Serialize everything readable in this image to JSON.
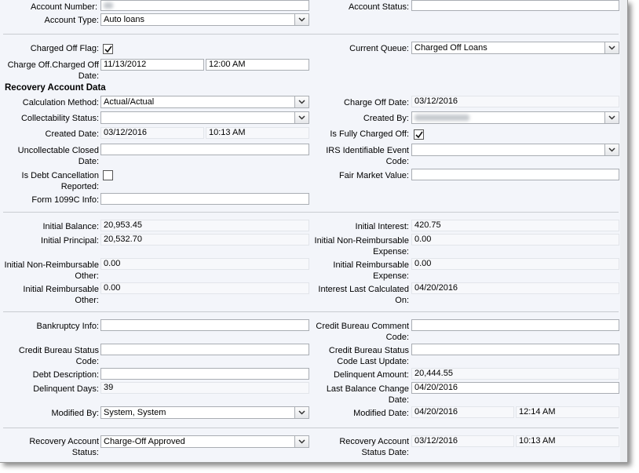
{
  "header": {
    "account_number_label": "Account Number:",
    "account_status_label": "Account Status:",
    "account_status_value": "",
    "account_type_label": "Account Type:",
    "account_type_value": "Auto loans"
  },
  "charge_off": {
    "flag_label": "Charged Off Flag:",
    "flag_checked": true,
    "current_queue_label": "Current Queue:",
    "current_queue_value": "Charged Off Loans",
    "charged_off_date_label": "Charge Off.Charged Off Date:",
    "charged_off_date_value": "11/13/2012",
    "charged_off_time_value": "12:00 AM"
  },
  "recovery": {
    "section_title": "Recovery Account Data",
    "calculation_method_label": "Calculation Method:",
    "calculation_method_value": "Actual/Actual",
    "charge_off_date_label": "Charge Off Date:",
    "charge_off_date_value": "03/12/2016",
    "collectability_status_label": "Collectability Status:",
    "collectability_status_value": "",
    "created_by_label": "Created By:",
    "created_date_label": "Created Date:",
    "created_date_value": "03/12/2016",
    "created_time_value": "10:13 AM",
    "is_fully_charged_off_label": "Is Fully Charged Off:",
    "is_fully_charged_off_checked": true,
    "uncollectable_closed_date_label": "Uncollectable Closed Date:",
    "uncollectable_closed_date_value": "",
    "irs_event_code_label": "IRS Identifiable Event Code:",
    "irs_event_code_value": "",
    "debt_cancellation_label": "Is Debt Cancellation Reported:",
    "debt_cancellation_checked": false,
    "fair_market_value_label": "Fair Market Value:",
    "fair_market_value_value": "",
    "form_1099c_label": "Form 1099C Info:",
    "form_1099c_value": ""
  },
  "balances": {
    "initial_balance_label": "Initial Balance:",
    "initial_balance_value": "20,953.45",
    "initial_interest_label": "Initial Interest:",
    "initial_interest_value": "420.75",
    "initial_principal_label": "Initial Principal:",
    "initial_principal_value": "20,532.70",
    "initial_nonreimb_expense_label": "Initial Non-Reimbursable Expense:",
    "initial_nonreimb_expense_value": "0.00",
    "initial_nonreimb_other_label": "Initial Non-Reimbursable Other:",
    "initial_nonreimb_other_value": "0.00",
    "initial_reimb_expense_label": "Initial Reimbursable Expense:",
    "initial_reimb_expense_value": "0.00",
    "initial_reimb_other_label": "Initial Reimbursable Other:",
    "initial_reimb_other_value": "0.00",
    "interest_last_calculated_label": "Interest Last Calculated On:",
    "interest_last_calculated_value": "04/20/2016"
  },
  "bureau": {
    "bankruptcy_info_label": "Bankruptcy Info:",
    "bankruptcy_info_value": "",
    "credit_bureau_comment_label": "Credit Bureau Comment Code:",
    "credit_bureau_comment_value": "",
    "credit_bureau_status_label": "Credit Bureau Status Code:",
    "credit_bureau_status_value": "",
    "credit_bureau_status_update_label": "Credit Bureau Status Code Last Update:",
    "credit_bureau_status_update_value": "",
    "debt_description_label": "Debt Description:",
    "debt_description_value": "",
    "delinquent_amount_label": "Delinquent Amount:",
    "delinquent_amount_value": "20,444.55",
    "delinquent_days_label": "Delinquent Days:",
    "delinquent_days_value": "39",
    "last_balance_change_label": "Last Balance Change Date:",
    "last_balance_change_value": "04/20/2016",
    "modified_by_label": "Modified By:",
    "modified_by_value": "System, System",
    "modified_date_label": "Modified Date:",
    "modified_date_value": "04/20/2016",
    "modified_time_value": "12:14 AM"
  },
  "recovery_status": {
    "status_label": "Recovery Account Status:",
    "status_value": "Charge-Off Approved",
    "status_date_label": "Recovery Account Status Date:",
    "status_date_value": "03/12/2016",
    "status_time_value": "10:13 AM"
  },
  "icons": {
    "dropdown": "chevron-down-icon",
    "check": "check-icon"
  },
  "colors": {
    "background": "#f3f5fa",
    "field_border": "#a9adb3",
    "separator": "#c9ccd1"
  }
}
